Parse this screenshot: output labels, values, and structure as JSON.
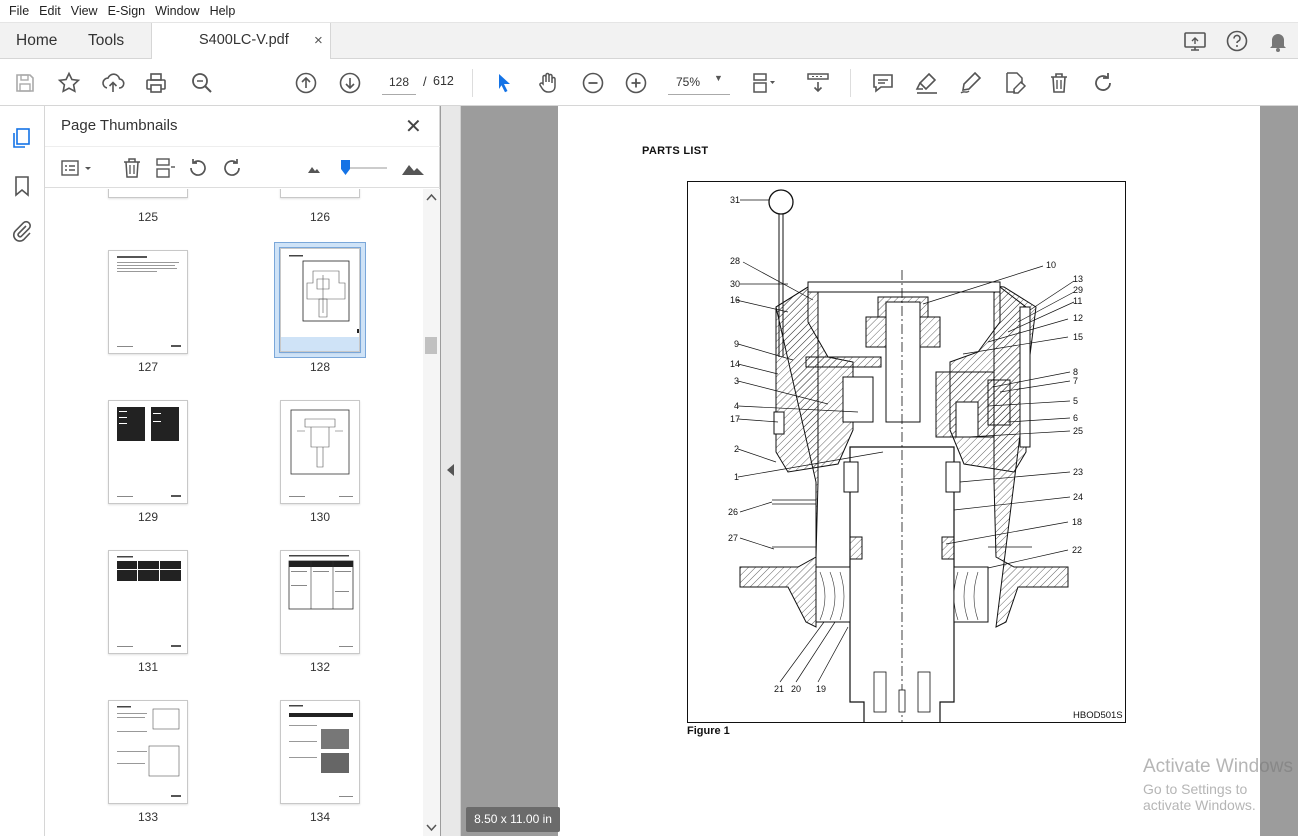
{
  "menu": [
    "File",
    "Edit",
    "View",
    "E-Sign",
    "Window",
    "Help"
  ],
  "tabs": {
    "home": "Home",
    "tools": "Tools",
    "document": "S400LC-V.pdf",
    "close": "×"
  },
  "toolbar": {
    "current_page": "128",
    "separator": "/",
    "total_pages": "612",
    "zoom": "75%"
  },
  "thumb_panel": {
    "title": "Page Thumbnails",
    "close": "✕",
    "labels": [
      "125",
      "126",
      "127",
      "128",
      "129",
      "130",
      "131",
      "132",
      "133",
      "134"
    ],
    "selected_page": "128"
  },
  "document": {
    "heading": "PARTS LIST",
    "figure_caption": "Figure 1",
    "figure_code": "HBOD501S",
    "callouts": [
      "31",
      "28",
      "30",
      "16",
      "9",
      "14",
      "3",
      "4",
      "17",
      "2",
      "1",
      "26",
      "27",
      "21",
      "20",
      "19",
      "10",
      "13",
      "29",
      "11",
      "12",
      "15",
      "8",
      "7",
      "5",
      "6",
      "25",
      "23",
      "24",
      "18",
      "22"
    ],
    "page_size": "8.50 x 11.00 in"
  },
  "watermark": {
    "line1": "Activate Windows",
    "line2": "Go to Settings to activate Windows."
  },
  "colors": {
    "accent": "#1473e6",
    "doc_background": "#9c9c9c",
    "selected_thumb": "#cfe3f7"
  }
}
